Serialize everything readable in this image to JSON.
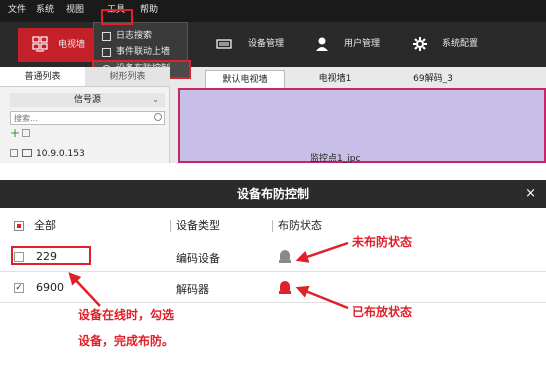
{
  "menubar": {
    "items": [
      "文件",
      "系统",
      "视图",
      "工具",
      "帮助"
    ]
  },
  "tools_menu": {
    "items": [
      "日志搜索",
      "事件联动上墙",
      "设备布防控制"
    ]
  },
  "toolbar": {
    "items": [
      {
        "label": "电视墙",
        "icon": "monitor-grid-icon"
      },
      {
        "label": "设备管理",
        "icon": "device-icon"
      },
      {
        "label": "用户管理",
        "icon": "user-icon"
      },
      {
        "label": "系统配置",
        "icon": "gear-icon"
      }
    ]
  },
  "left_panel": {
    "tabs": [
      "普通列表",
      "树形列表"
    ],
    "signal_source": "信号源",
    "search_placeholder": "搜索...",
    "tree_item": "10.9.0.153"
  },
  "wall_tabs": [
    "默认电视墙",
    "电视墙1",
    "69解码_3"
  ],
  "canvas": {
    "label": "监控点1_ipc"
  },
  "dialog": {
    "title": "设备布防控制",
    "close": "×",
    "headers": {
      "all": "全部",
      "type": "设备类型",
      "status": "布防状态"
    },
    "rows": [
      {
        "name": "229",
        "type": "编码设备",
        "checked": false,
        "armed": false,
        "check_mark": ""
      },
      {
        "name": "6900",
        "type": "解码器",
        "checked": true,
        "armed": true,
        "check_mark": "✓"
      }
    ]
  },
  "annotations": {
    "unarmed": "未布防状态",
    "armed": "已布放状态",
    "instruction_line1": "设备在线时，勾选",
    "instruction_line2": "设备，完成布防。"
  },
  "colors": {
    "accent_red": "#e0202a",
    "menubar_bg": "#1a1a1a",
    "toolbar_bg": "#2a2a2a",
    "canvas_bg": "#c8bfe8",
    "status_unarmed": "#8a8a8a",
    "status_armed": "#e0202a"
  }
}
